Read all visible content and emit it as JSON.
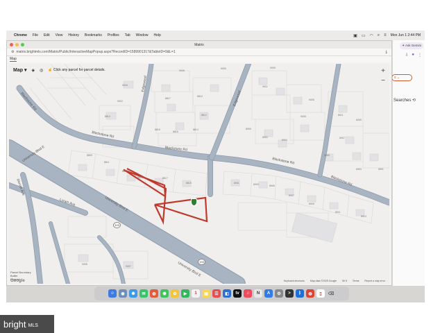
{
  "menubar": {
    "app": "Chrome",
    "items": [
      "File",
      "Edit",
      "View",
      "History",
      "Bookmarks",
      "Profiles",
      "Tab",
      "Window",
      "Help"
    ],
    "clock": "Mon Jun 1  2:44 PM"
  },
  "window": {
    "title": "Matrix",
    "url": "matrix.brightmls.com/Matrix/Public/InteractiveMapPopup.aspx?RecordID=1589901317&TableID=9&L=1",
    "tab_label": "Map"
  },
  "map": {
    "map_button": "Map",
    "hint": "Click any parcel for parcel details.",
    "zoom_in": "+",
    "zoom_out": "−",
    "streets": {
      "blackstone_upper": "Blackstone Rd",
      "blackstone_mid": "Blackstone Rd",
      "blackstone_right": "Blackstone Rd",
      "blackstone_far": "Blackstone Rd",
      "university_upper": "University Blvd E",
      "university_lower": "University Blvd E",
      "lorain": "Lorain Ave",
      "dennis": "Dennis Ave",
      "edgewood": "Edgewood"
    },
    "route_shields": [
      "193",
      "193"
    ],
    "legend": [
      "Parcel Boundary",
      "Buffer",
      "Legend"
    ],
    "google": "Google",
    "attribution": [
      "Keyboard shortcuts",
      "Map data ©2025 Google",
      "50 ft",
      "Terms",
      "Report a map error"
    ]
  },
  "sidepanel": {
    "ask_gemini": "Ask Gemini",
    "pill_text": "s",
    "searches": "Searches"
  },
  "brand": {
    "name": "bright",
    "suffix": "MLS"
  },
  "colors": {
    "parcel_outline": "#c0392b",
    "road": "#a8b4c2",
    "road_edge": "#8d9bab",
    "map_bg": "#f0efed"
  }
}
